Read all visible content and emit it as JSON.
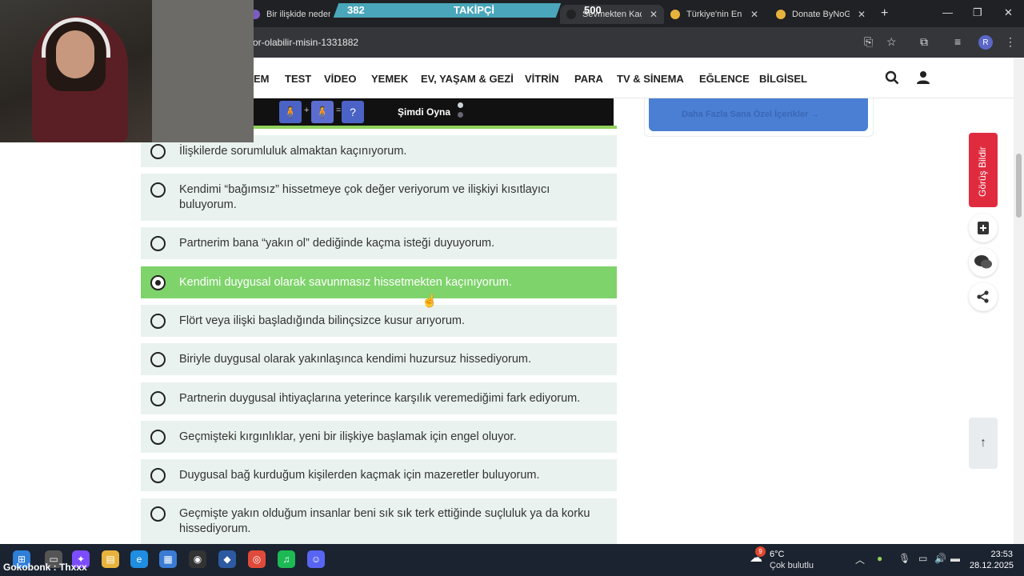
{
  "browser": {
    "tabs": [
      {
        "label": "Bir ilişkide neden",
        "active": false
      },
      {
        "label": "Sevmekten Kaçı",
        "active": true
      },
      {
        "label": "Türkiye'nin En B",
        "active": false
      },
      {
        "label": "Donate ByNoGa",
        "active": false
      }
    ],
    "url": "or-olabilir-misin-1331882",
    "profile_initial": "R"
  },
  "overlay": {
    "follow_count": "382",
    "follow_label": "TAKİPÇİ",
    "follow_goal": "500",
    "alert_text": "Gokobonk : Thxxx"
  },
  "site_nav": {
    "items": [
      "EM",
      "TEST",
      "VİDEO",
      "YEMEK",
      "EV, YAŞAM & GEZİ",
      "VİTRİN",
      "PARA",
      "TV & SİNEMA",
      "EĞLENCE",
      "BİLGİSEL"
    ]
  },
  "game_bar": {
    "tiles": [
      "🧍",
      "+",
      "🧍",
      "=",
      "?"
    ],
    "play_label": "Şimdi Oyna"
  },
  "side_banner": {
    "text": "Daha Fazla Sana Özel İçerikler  →"
  },
  "quiz": {
    "options": [
      {
        "text": "İlişkilerde sorumluluk almaktan kaçınıyorum.",
        "selected": false
      },
      {
        "text": "Kendimi “bağımsız” hissetmeye çok değer veriyorum ve ilişkiyi kısıtlayıcı buluyorum.",
        "selected": false
      },
      {
        "text": "Partnerim bana “yakın ol” dediğinde kaçma isteği duyuyorum.",
        "selected": false
      },
      {
        "text": "Kendimi duygusal olarak savunmasız hissetmekten kaçınıyorum.",
        "selected": true
      },
      {
        "text": "Flört veya ilişki başladığında bilinçsizce kusur arıyorum.",
        "selected": false
      },
      {
        "text": "Biriyle duygusal olarak yakınlaşınca kendimi huzursuz hissediyorum.",
        "selected": false
      },
      {
        "text": "Partnerin duygusal ihtiyaçlarına yeterince karşılık veremediğimi fark ediyorum.",
        "selected": false
      },
      {
        "text": "Geçmişteki kırgınlıklar, yeni bir ilişkiye başlamak için engel oluyor.",
        "selected": false
      },
      {
        "text": "Duygusal bağ kurduğum kişilerden kaçmak için mazeretler buluyorum.",
        "selected": false
      },
      {
        "text": "Geçmişte yakın olduğum insanlar beni sık sık terk ettiğinde suçluluk ya da korku hissediyorum.",
        "selected": false
      }
    ]
  },
  "floating": {
    "feedback_label": "Görüş Bildir"
  },
  "taskbar": {
    "weather_temp": "6°C",
    "weather_desc": "Çok bulutlu",
    "weather_badge": "9",
    "time": "23:53",
    "date": "28.12.2025"
  },
  "colors": {
    "selected_option": "#7ed36b",
    "option_bg": "#e9f2ee",
    "feedback": "#e02b3f",
    "follow_bar": "#4aa6ba"
  }
}
